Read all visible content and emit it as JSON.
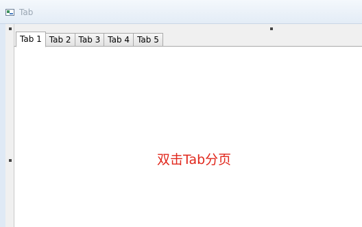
{
  "window": {
    "title": "Tab",
    "icon": "app-window-icon"
  },
  "tabs": [
    {
      "label": "Tab 1",
      "active": true
    },
    {
      "label": "Tab 2",
      "active": false
    },
    {
      "label": "Tab 3",
      "active": false
    },
    {
      "label": "Tab 4",
      "active": false
    },
    {
      "label": "Tab 5",
      "active": false
    }
  ],
  "content": {
    "hint": "双击Tab分页"
  },
  "colors": {
    "hint": "#e0261b",
    "tab_border": "#a9a9a9"
  }
}
